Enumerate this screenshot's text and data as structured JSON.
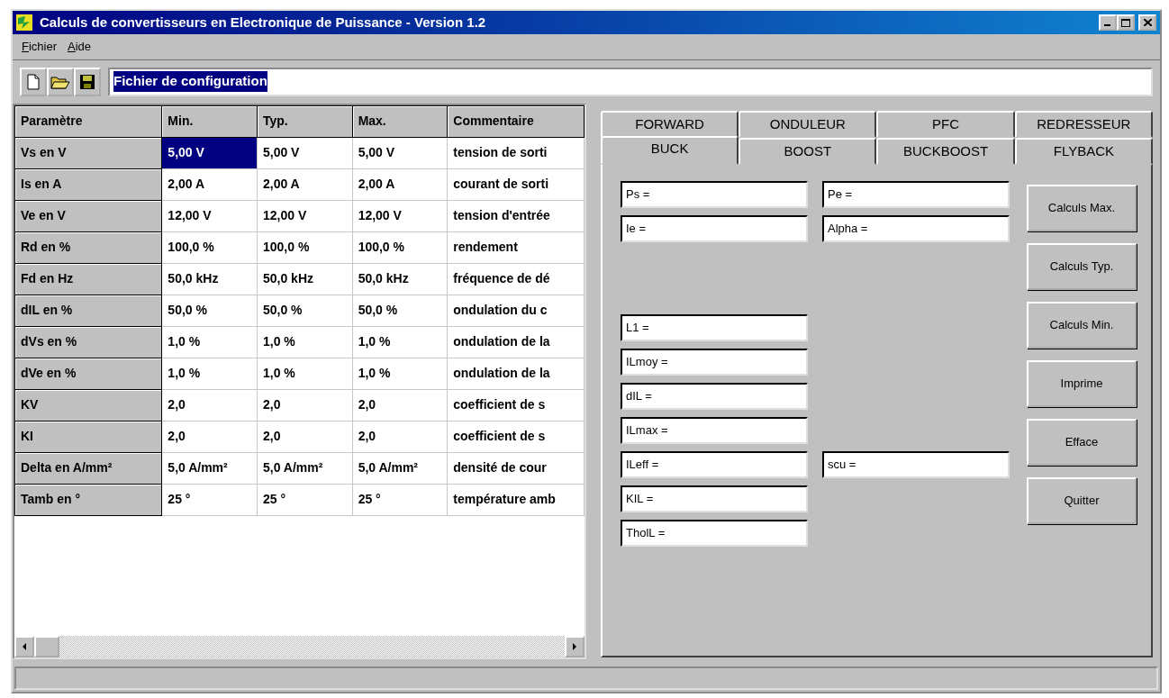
{
  "window": {
    "title": "Calculs de convertisseurs en Electronique de Puissance - Version 1.2"
  },
  "menu": [
    {
      "label": "Fichier"
    },
    {
      "label": "Aide"
    }
  ],
  "toolbar": {
    "file_field": {
      "value": "Fichier de configuration",
      "selected": true
    }
  },
  "table": {
    "columns": [
      "Paramètre",
      "Min.",
      "Typ.",
      "Max.",
      "Commentaire"
    ],
    "rows": [
      {
        "cells": [
          {
            "text": "Vs en V",
            "selected": false
          },
          {
            "text": "5,00 V",
            "selected": true
          },
          {
            "text": "5,00 V",
            "selected": false
          },
          {
            "text": "5,00 V",
            "selected": false
          },
          {
            "text": "tension de sorti",
            "selected": false
          }
        ]
      },
      {
        "cells": [
          {
            "text": "Is en A",
            "selected": false
          },
          {
            "text": "2,00 A",
            "selected": false
          },
          {
            "text": "2,00 A",
            "selected": false
          },
          {
            "text": "2,00 A",
            "selected": false
          },
          {
            "text": "courant de sorti",
            "selected": false
          }
        ]
      },
      {
        "cells": [
          {
            "text": "Ve en V",
            "selected": false
          },
          {
            "text": "12,00 V",
            "selected": false
          },
          {
            "text": "12,00 V",
            "selected": false
          },
          {
            "text": "12,00 V",
            "selected": false
          },
          {
            "text": "tension d'entrée",
            "selected": false
          }
        ]
      },
      {
        "cells": [
          {
            "text": "Rd en %",
            "selected": false
          },
          {
            "text": "100,0 %",
            "selected": false
          },
          {
            "text": "100,0 %",
            "selected": false
          },
          {
            "text": "100,0 %",
            "selected": false
          },
          {
            "text": "rendement",
            "selected": false
          }
        ]
      },
      {
        "cells": [
          {
            "text": "Fd en Hz",
            "selected": false
          },
          {
            "text": "50,0 kHz",
            "selected": false
          },
          {
            "text": "50,0 kHz",
            "selected": false
          },
          {
            "text": "50,0 kHz",
            "selected": false
          },
          {
            "text": "fréquence de dé",
            "selected": false
          }
        ]
      },
      {
        "cells": [
          {
            "text": "dIL en %",
            "selected": false
          },
          {
            "text": "50,0 %",
            "selected": false
          },
          {
            "text": "50,0 %",
            "selected": false
          },
          {
            "text": "50,0 %",
            "selected": false
          },
          {
            "text": "ondulation du c",
            "selected": false
          }
        ]
      },
      {
        "cells": [
          {
            "text": "dVs en %",
            "selected": false
          },
          {
            "text": "1,0 %",
            "selected": false
          },
          {
            "text": "1,0 %",
            "selected": false
          },
          {
            "text": "1,0 %",
            "selected": false
          },
          {
            "text": "ondulation de la",
            "selected": false
          }
        ]
      },
      {
        "cells": [
          {
            "text": "dVe en %",
            "selected": false
          },
          {
            "text": "1,0 %",
            "selected": false
          },
          {
            "text": "1,0 %",
            "selected": false
          },
          {
            "text": "1,0 %",
            "selected": false
          },
          {
            "text": "ondulation de la",
            "selected": false
          }
        ]
      },
      {
        "cells": [
          {
            "text": "KV",
            "selected": false
          },
          {
            "text": "2,0",
            "selected": false
          },
          {
            "text": "2,0",
            "selected": false
          },
          {
            "text": "2,0",
            "selected": false
          },
          {
            "text": "coefficient de s",
            "selected": false
          }
        ]
      },
      {
        "cells": [
          {
            "text": "KI",
            "selected": false
          },
          {
            "text": "2,0",
            "selected": false
          },
          {
            "text": "2,0",
            "selected": false
          },
          {
            "text": "2,0",
            "selected": false
          },
          {
            "text": "coefficient de s",
            "selected": false
          }
        ]
      },
      {
        "cells": [
          {
            "text": "Delta en A/mm²",
            "selected": false
          },
          {
            "text": "5,0 A/mm²",
            "selected": false
          },
          {
            "text": "5,0 A/mm²",
            "selected": false
          },
          {
            "text": "5,0 A/mm²",
            "selected": false
          },
          {
            "text": "densité de cour",
            "selected": false
          }
        ]
      },
      {
        "cells": [
          {
            "text": "Tamb en °",
            "selected": false
          },
          {
            "text": "25 °",
            "selected": false
          },
          {
            "text": "25 °",
            "selected": false
          },
          {
            "text": "25 °",
            "selected": false
          },
          {
            "text": "température amb",
            "selected": false
          }
        ]
      }
    ]
  },
  "tab_rows": [
    [
      {
        "label": "FORWARD",
        "selected": false
      },
      {
        "label": "ONDULEUR",
        "selected": false
      },
      {
        "label": "PFC",
        "selected": false
      },
      {
        "label": "REDRESSEUR",
        "selected": false
      }
    ],
    [
      {
        "label": "BUCK",
        "selected": true
      },
      {
        "label": "BOOST",
        "selected": false
      },
      {
        "label": "BUCKBOOST",
        "selected": false
      },
      {
        "label": "FLYBACK",
        "selected": false
      }
    ]
  ],
  "fields_top": [
    [
      "Ps =",
      "Pe ="
    ],
    [
      "Ie =",
      "Alpha ="
    ]
  ],
  "fields_bottom": [
    [
      "L1 ="
    ],
    [
      "ILmoy ="
    ],
    [
      "dIL ="
    ],
    [
      "ILmax ="
    ],
    [
      "ILeff =",
      "scu ="
    ],
    [
      "KIL ="
    ],
    [
      "TholL ="
    ]
  ],
  "buttons": [
    "Calculs Max.",
    "Calculs Typ.",
    "Calculs Min.",
    "Imprime",
    "Efface",
    "Quitter"
  ]
}
